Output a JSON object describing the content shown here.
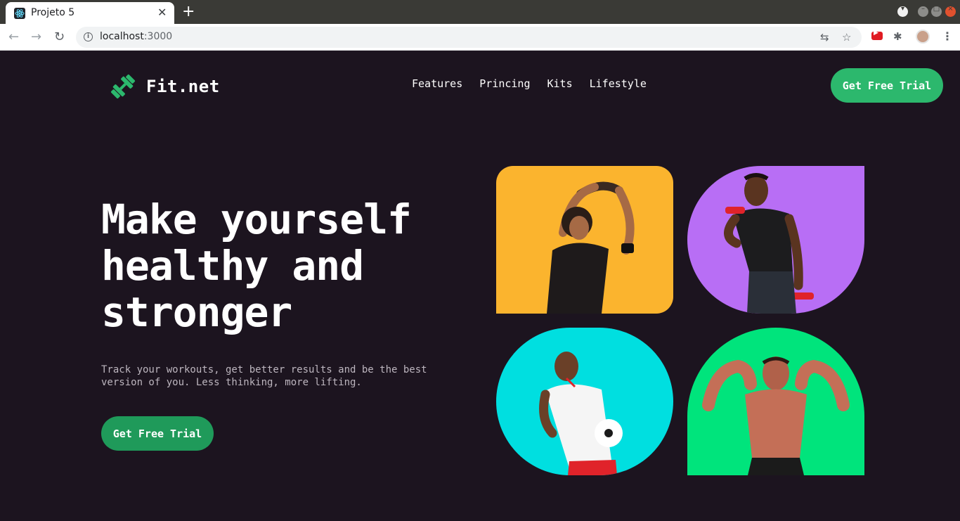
{
  "browser": {
    "tab_title": "Projeto 5",
    "tab_close": "✕",
    "new_tab": "+",
    "url_host": "localhost",
    "url_port": ":3000",
    "info_glyph": "i",
    "back_glyph": "←",
    "forward_glyph": "→",
    "reload_glyph": "↻",
    "translate_glyph": "⇆",
    "star_glyph": "☆",
    "puzzle_glyph": "✱",
    "kebab_glyph": "⋮",
    "window_menu_glyph": "▾",
    "window_min_glyph": "–",
    "window_max_glyph": "□",
    "window_close_glyph": "×"
  },
  "site": {
    "logo_text": "Fit.net",
    "brand_color": "#2cb86d",
    "background": "#1c141f",
    "nav": [
      "Features",
      "Princing",
      "Kits",
      "Lifestyle"
    ],
    "cta_top": "Get Free Trial"
  },
  "hero": {
    "title": "Make yourself healthy and stronger",
    "subtitle": "Track your workouts, get better results and be the best version of you. Less thinking, more lifting.",
    "cta": "Get Free Trial"
  },
  "gallery": {
    "tiles": [
      {
        "color": "#fbb42e",
        "subject": "man-stretching-arms"
      },
      {
        "color": "#b86ef5",
        "subject": "man-with-red-dumbbells"
      },
      {
        "color": "#00dfe0",
        "subject": "man-holding-soccer-ball"
      },
      {
        "color": "#00e47c",
        "subject": "bodybuilder-flexing"
      }
    ]
  }
}
